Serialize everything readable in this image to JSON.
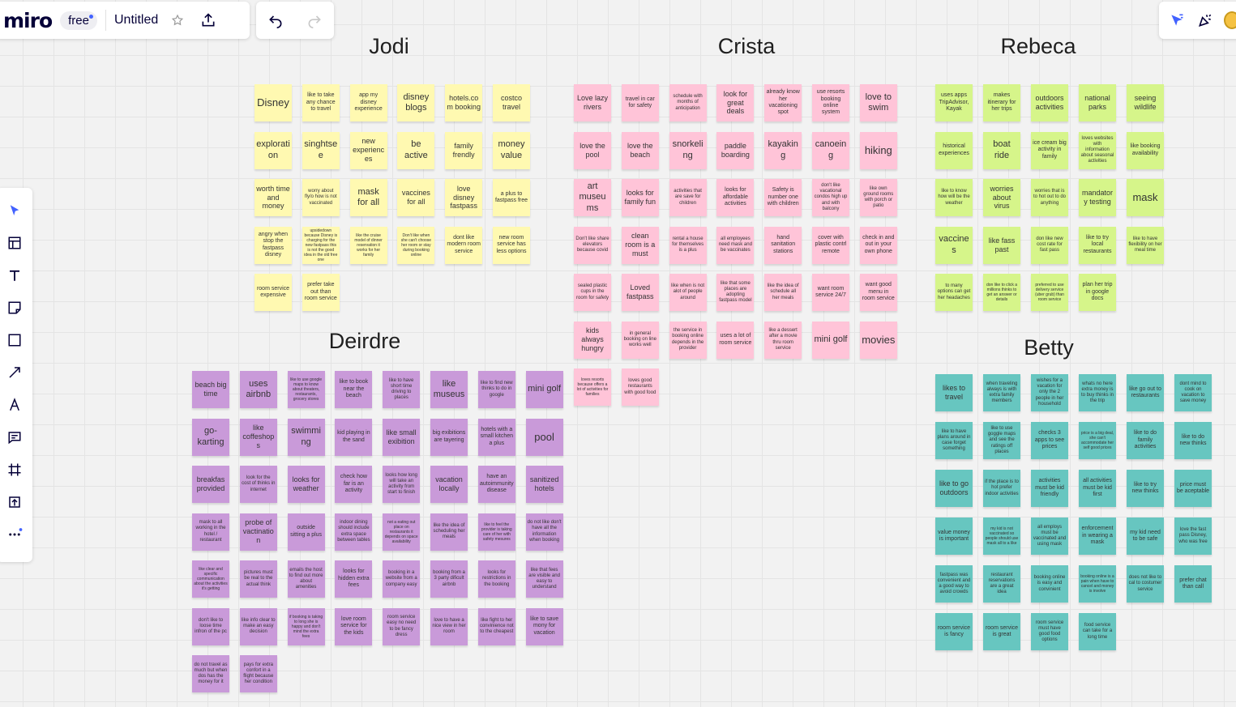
{
  "app": {
    "logo": "miro",
    "plan": "free",
    "board_title": "Untitled"
  },
  "colors": {
    "yellow": "#fff9b1",
    "pink": "#ffc4d8",
    "green": "#d6f58a",
    "purple": "#c99ad9",
    "teal": "#67c6c0",
    "accent": "#4262ff"
  },
  "toolbar": {
    "tools": [
      "cursor-icon",
      "templates-icon",
      "text-icon",
      "sticky-note-icon",
      "shape-icon",
      "connector-icon",
      "pen-icon",
      "comment-icon",
      "frame-icon",
      "upload-icon",
      "more-icon"
    ]
  },
  "clusters": [
    {
      "name": "Jodi",
      "color": "yellow",
      "notes": [
        [
          "Disney",
          "like to take any chance to travel",
          "app my disney experience",
          "disney blogs",
          "hotels.com booking",
          "costco travel"
        ],
        [
          "exploration",
          "singhtsee",
          "new experiences",
          "be active",
          "family frendly",
          "money value"
        ],
        [
          "worth time and money",
          "worry about fly/o how is not vaccinated",
          "mask for all",
          "vaccines for all",
          "love disney fastpass",
          "a plus to fastpass free"
        ],
        [
          "angry when stop the fastpass disney",
          "upsidedown because Disney is charging for the new fastpass this is not the good idea in the old free one",
          "like the cruise model of dinner reservation it works for her family",
          "Don't like when she can't choose her room or stay during booking online",
          "dont like modern room service",
          "new room service has less options"
        ],
        [
          "room service expensive",
          "prefer take out than room service"
        ]
      ]
    },
    {
      "name": "Crista",
      "color": "pink",
      "notes": [
        [
          "Love lazy rivers",
          "travel in car for safety",
          "schedule with months of anticipation",
          "look for great deals",
          "already know her vacationing spot",
          "use resorts booking online system",
          "love to swim"
        ],
        [
          "love the pool",
          "love the beach",
          "snorkeling",
          "paddle boarding",
          "kayaking",
          "canoeing",
          "hiking"
        ],
        [
          "art museums",
          "looks for family fun",
          "activities that are save for children",
          "looks for affordable activities",
          "Safety is number one with children",
          "don't like vacational condos high up and with balcony",
          "like own ground rooms with porch or patio"
        ],
        [
          "Don't like share elevators because covid",
          "clean room is a must",
          "rental a house for themselves is a plus",
          "all employees need mask and be vaccinates",
          "hand sanitation stations",
          "cover with plastic contrl remote",
          "check in and out in your own phone"
        ],
        [
          "sealed plastic cups in the room for safety",
          "Loved fastpass",
          "like when is not alot of people around",
          "like that some places are adopting fastpass model",
          "like the idea of schedule all her meals",
          "want room service 24/7",
          "want good menu in room service"
        ],
        [
          "kids always hungry",
          "in general booking on line works well",
          "the service in booking online depends in the provider",
          "uses a lot of room service",
          "like a dessert after a movie thru room service",
          "mini golf",
          "movies"
        ],
        [
          "loves resorts because offers a lot of activities for families",
          "loves good restaurants with good food"
        ]
      ]
    },
    {
      "name": "Rebeca",
      "color": "green",
      "notes": [
        [
          "uses apps TripAdvisor, Kayak",
          "makes itinerary for her trips",
          "outdoors activities",
          "national parks",
          "seeing wildlife"
        ],
        [
          "historical experiences",
          "boat ride",
          "ice cream big activity in family",
          "loves websites with information about seasonal activities",
          "like booking availability"
        ],
        [
          "like to know how will be the weather",
          "worries about virus",
          "worries that is to hot out to do anything",
          "mandatory testing",
          "mask"
        ],
        [
          "vaccines",
          "like fass past",
          "don like new cost rate for fast pass",
          "like to try local restaurants",
          "like to have flexibility on her meal time"
        ],
        [
          "to many options can get her headaches",
          "don like to click a millions thinks to get an answer or details",
          "preferred to use delivery service (uber grub) than room service",
          "plan her trip in google docs"
        ]
      ]
    },
    {
      "name": "Deirdre",
      "color": "purple",
      "notes": [
        [
          "beach big time",
          "uses airbnb",
          "like to use google maps to know about theaters, restaurants, grocery stores",
          "like to book near the beach",
          "like to have short time driving to places",
          "like museus",
          "like to find new thinks to do in google",
          "mini golf"
        ],
        [
          "go-karting",
          "like coffeshops",
          "swimming",
          "kid playing in the sand",
          "like small exibition",
          "big exibitions are tayering",
          "hotels with a small kitchen a plus",
          "pool"
        ],
        [
          "breakfas provided",
          "look for the cost of thinks in internet",
          "looks for weather",
          "check how far is an activity",
          "looks how long will take an activity from start to finish",
          "vacation locally",
          "have an autoimmunity disease",
          "sanitized hotels"
        ],
        [
          "mask to all working in the hotel / restaurant",
          "probe of vactination",
          "outside sitting a plus",
          "indoor dining should include extra space between tables",
          "not a eating out place on restaurants it depends on space availability",
          "like the idea of scheduling her meals",
          "like to feel the provider is taking care of her with safety mesures",
          "do not like don't have all the information when booking"
        ],
        [
          "like clear and specific communication about the activities it's getting",
          "pictures must be real to the actual think",
          "emails the host to find out more about amenities",
          "looks for hidden extra fees",
          "booking in a website from a company easy",
          "booking from a 3 party dificult airbnb",
          "looks for restrictions in the booking",
          "like that fees are visible and easy to understand"
        ],
        [
          "don't like to loose time infron of the pc",
          "like info clear to make an easy decision",
          "if booking is taking to long she is happy and don't mind the extra fees",
          "love room service for the kids",
          "room service easy no need to be fancy dress",
          "love to have a nice view in her room",
          "like fight to her convinience not to the cheapest",
          "like to save mony for vacation"
        ],
        [
          "do not travel as much but when dos has the money for it",
          "pays for extra confort in a flight because her condition"
        ]
      ]
    },
    {
      "name": "Betty",
      "color": "teal",
      "notes": [
        [
          "likes to travel",
          "when traveling always is with extra family members",
          "wishes for a vacation for only the 2 people in her household",
          "whats no here extra money is to buy thinks in the trip",
          "like go out to restaurants",
          "dont mind to cook on vacation to save money"
        ],
        [
          "like to have plans around in case forget something",
          "like to use goggle maps and see the ratings off places",
          "checks 3 apps to see prices",
          "price is a big deal, she can't accommodate her self good prices",
          "like to do family activities",
          "like to do new thinks"
        ],
        [
          "like to go outdoors",
          "if the place is to hot prefer indoor activities",
          "activities must be kid friendly",
          "all activities must be kid first",
          "like to try new thinks",
          "price must be aceptable"
        ],
        [
          "value money is important",
          "my kid is not vaccinated so people should use mask all to a like",
          "all employs must be vaccinated and using mask",
          "enforcement in wearing a mask",
          "my kid need to be safe",
          "love the fast pass Disney, who was free"
        ],
        [
          "fastpass was convenient and a good way to avoid crowds",
          "restaurant reservations are a great idea",
          "booking online is easy and convinient",
          "booking online is a pain when have to cancel and money is involve",
          "does not like to cal to costumer service",
          "prefer chat than call"
        ],
        [
          "room service is fancy",
          "room service is great",
          "room service must have good food options",
          "food service can take for a long time"
        ]
      ]
    }
  ]
}
